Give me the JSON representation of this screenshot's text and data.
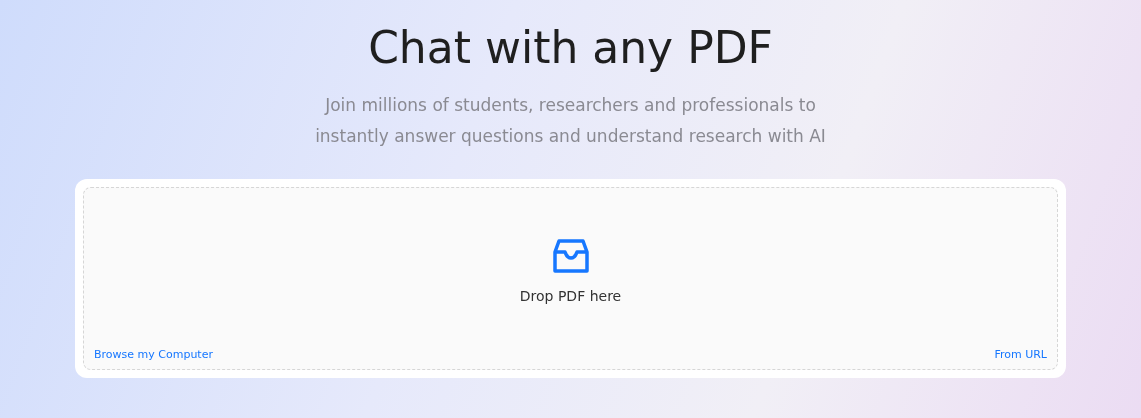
{
  "title": "Chat with any PDF",
  "subtitle": [
    "Join millions of students, researchers and professionals to",
    "instantly answer questions and understand research with AI"
  ],
  "upload": {
    "prompt": "Drop PDF here",
    "links": [
      "Browse my Computer",
      "From URL"
    ]
  }
}
